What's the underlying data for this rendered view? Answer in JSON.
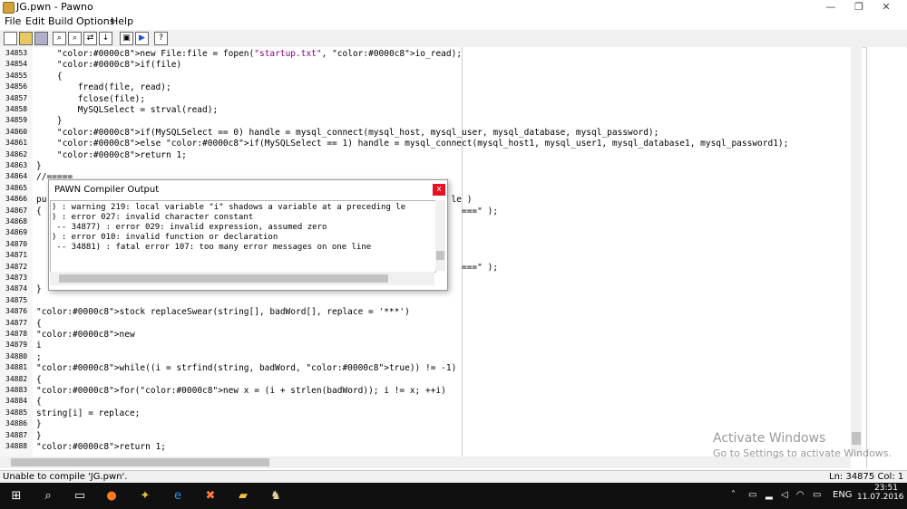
{
  "window": {
    "title": "JG.pwn - Pawno",
    "minimize": "—",
    "restore": "❐",
    "close": "✕"
  },
  "menu": [
    "File",
    "Edit",
    "Build",
    "Options",
    "Help"
  ],
  "editor": {
    "lines": [
      {
        "n": "34853",
        "t": "    new File:file = fopen(\"startup.txt\", io_read);"
      },
      {
        "n": "34854",
        "t": "    if(file)"
      },
      {
        "n": "34855",
        "t": "    {"
      },
      {
        "n": "34856",
        "t": "        fread(file, read);"
      },
      {
        "n": "34857",
        "t": "        fclose(file);"
      },
      {
        "n": "34858",
        "t": "        MySQLSelect = strval(read);"
      },
      {
        "n": "34859",
        "t": "    }"
      },
      {
        "n": "34860",
        "t": "    if(MySQLSelect == 0) handle = mysql_connect(mysql_host, mysql_user, mysql_database, mysql_password);"
      },
      {
        "n": "34861",
        "t": "    else if(MySQLSelect == 1) handle = mysql_connect(mysql_host1, mysql_user1, mysql_database1, mysql_password1);"
      },
      {
        "n": "34862",
        "t": "    return 1;"
      },
      {
        "n": "34863",
        "t": "}"
      },
      {
        "n": "34864",
        "t": "//====="
      },
      {
        "n": "34865",
        "t": ""
      },
      {
        "n": "34866",
        "t": "pu                                                                              le )"
      },
      {
        "n": "34867",
        "t": "{                                                                                 ===\" );"
      },
      {
        "n": "34868",
        "t": ""
      },
      {
        "n": "34869",
        "t": ""
      },
      {
        "n": "34870",
        "t": ""
      },
      {
        "n": "34871",
        "t": ""
      },
      {
        "n": "34872",
        "t": "                                                                                  ===\" );"
      },
      {
        "n": "34873",
        "t": ""
      },
      {
        "n": "34874",
        "t": "}"
      },
      {
        "n": "34875",
        "t": ""
      },
      {
        "n": "34876",
        "t": "stock replaceSwear(string[], badWord[], replace = '***')"
      },
      {
        "n": "34877",
        "t": "{"
      },
      {
        "n": "34878",
        "t": "new"
      },
      {
        "n": "34879",
        "t": "i"
      },
      {
        "n": "34880",
        "t": ";"
      },
      {
        "n": "34881",
        "t": "while((i = strfind(string, badWord, true)) != -1)"
      },
      {
        "n": "34882",
        "t": "{"
      },
      {
        "n": "34883",
        "t": "for(new x = (i + strlen(badWord)); i != x; ++i)"
      },
      {
        "n": "34884",
        "t": "{"
      },
      {
        "n": "34885",
        "t": "string[i] = replace;"
      },
      {
        "n": "34886",
        "t": "}"
      },
      {
        "n": "34887",
        "t": "}"
      },
      {
        "n": "34888",
        "t": "return 1;"
      }
    ]
  },
  "dialog": {
    "title": "PAWN Compiler Output",
    "close": "x",
    "lines": [
      ") : warning 219: local variable \"i\" shadows a variable at a preceding le",
      ") : error 027: invalid character constant",
      " -- 34877) : error 029: invalid expression, assumed zero",
      ") : error 010: invalid function or declaration",
      " -- 34881) : fatal error 107: too many error messages on one line"
    ]
  },
  "status": {
    "left": "Unable to compile 'JG.pwn'.",
    "right": "Ln: 34875  Col: 1"
  },
  "watermark": {
    "title": "Activate Windows",
    "subtitle": "Go to Settings to activate Windows."
  },
  "taskbar": {
    "lang": "ENG",
    "time": "23:51",
    "date": "11.07.2016"
  }
}
